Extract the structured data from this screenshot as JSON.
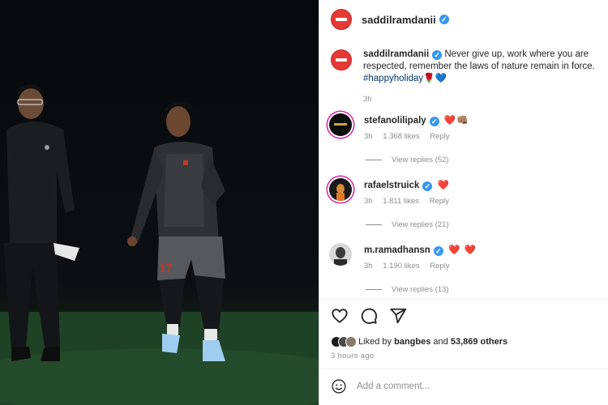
{
  "header": {
    "username": "saddilramdanii",
    "verified_icon": "verified-badge-icon"
  },
  "caption": {
    "username": "saddilramdanii",
    "text": "Never give up, work where you are respected, remember the laws of nature remain in force.",
    "hashtag": "#happyholiday",
    "emoji": "🌹💙",
    "time": "3h"
  },
  "comments": [
    {
      "username": "stefanolilipaly",
      "text": "❤️👊🏽",
      "time": "3h",
      "likes": "1.368 likes",
      "reply": "Reply",
      "view_replies": "View replies (52)"
    },
    {
      "username": "rafaelstruick",
      "text": "❤️",
      "time": "3h",
      "likes": "1.811 likes",
      "reply": "Reply",
      "view_replies": "View replies (21)"
    },
    {
      "username": "m.ramadhansn",
      "text": "❤️ ❤️",
      "time": "3h",
      "likes": "1.190 likes",
      "reply": "Reply",
      "view_replies": "View replies (13)"
    }
  ],
  "liked_by": {
    "prefix": "Liked by",
    "user": "bangbes",
    "joiner": "and",
    "others": "53,869 others"
  },
  "timeago": "3 hours ago",
  "add_comment": {
    "placeholder": "Add a comment..."
  },
  "colors": {
    "verified": "#3897f0",
    "heart": "#ed4956",
    "blocked_avatar": "#e53935",
    "hashtag": "#00376b"
  }
}
